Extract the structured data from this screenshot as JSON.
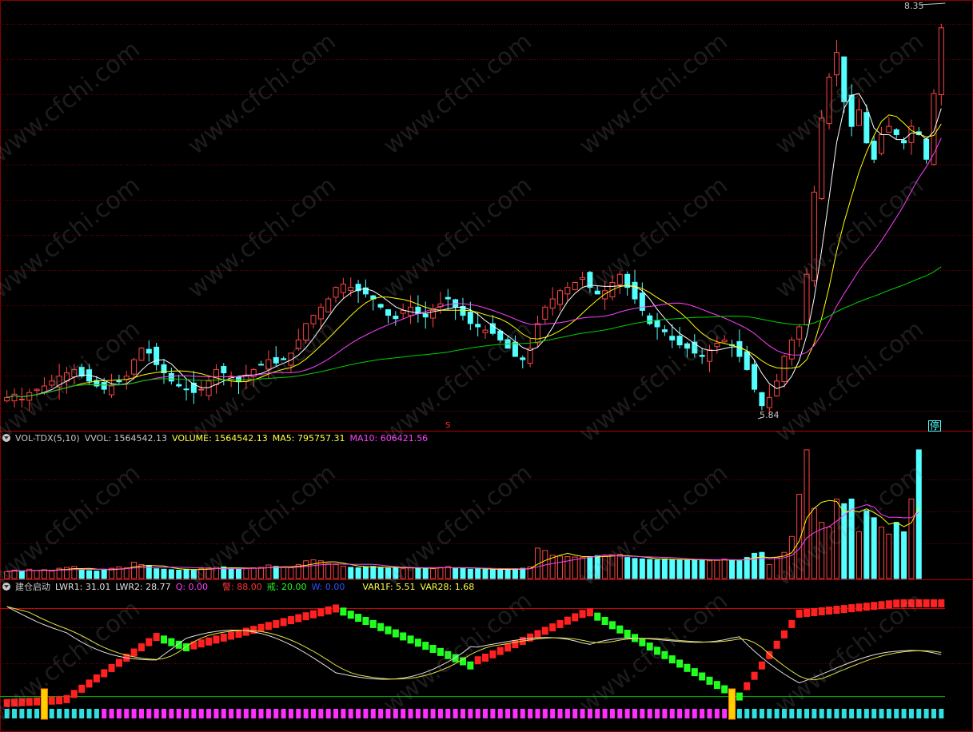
{
  "colors": {
    "up": "#ff4444",
    "down": "#54ffff",
    "ma_white": "#ffffff",
    "ma_yellow": "#ffff00",
    "ma_magenta": "#ff40ff",
    "ma_green": "#00d000",
    "grid": "#7a0000",
    "bg": "#000000"
  },
  "watermark": "www.cfchi.com",
  "main_panel": {
    "high_label": "8.35",
    "low_label": "5.84",
    "marker_s": "S",
    "marker_stop": "停"
  },
  "vol_panel": {
    "header": {
      "name": "VOL-TDX(5,10)",
      "vvol": "VVOL: 1564542.13",
      "volume": "VOLUME: 1564542.13",
      "ma5": "MA5: 795757.31",
      "ma10": "MA10: 606421.56"
    }
  },
  "ind_panel": {
    "header": {
      "name": "建仓启动",
      "lwr1": "LWR1: 31.01",
      "lwr2": "LWR2: 28.77",
      "q": "Q: 0.00",
      "jing": "警: 88.00",
      "jie": "戒: 20.00",
      "w": "W: 0.00",
      "var1f": "VAR1F: 5.51",
      "var28": "VAR28: 1.68"
    }
  },
  "chart_data": [
    {
      "type": "candlestick",
      "panel": "price",
      "price_high": 8.35,
      "price_low": 5.84,
      "closes": [
        5.95,
        5.97,
        5.94,
        5.98,
        6.0,
        6.02,
        6.05,
        6.08,
        6.1,
        6.12,
        6.08,
        6.05,
        6.02,
        6.0,
        6.02,
        6.05,
        6.08,
        6.18,
        6.25,
        6.22,
        6.15,
        6.1,
        6.05,
        6.02,
        6.0,
        5.98,
        6.0,
        6.05,
        6.12,
        6.1,
        6.08,
        6.05,
        6.08,
        6.12,
        6.15,
        6.18,
        6.16,
        6.18,
        6.22,
        6.3,
        6.4,
        6.45,
        6.5,
        6.55,
        6.62,
        6.64,
        6.62,
        6.6,
        6.58,
        6.55,
        6.5,
        6.45,
        6.43,
        6.48,
        6.5,
        6.46,
        6.44,
        6.48,
        6.52,
        6.55,
        6.5,
        6.45,
        6.4,
        6.38,
        6.36,
        6.34,
        6.3,
        6.25,
        6.2,
        6.18,
        6.25,
        6.4,
        6.5,
        6.55,
        6.6,
        6.62,
        6.65,
        6.68,
        6.62,
        6.58,
        6.6,
        6.65,
        6.7,
        6.62,
        6.55,
        6.48,
        6.4,
        6.38,
        6.35,
        6.3,
        6.27,
        6.25,
        6.22,
        6.2,
        6.24,
        6.28,
        6.3,
        6.27,
        6.2,
        6.12,
        6.0,
        5.9,
        5.95,
        6.05,
        6.2,
        6.3,
        6.38,
        6.7,
        7.2,
        7.65,
        7.9,
        8.05,
        7.75,
        7.6,
        7.7,
        7.5,
        7.4,
        7.55,
        7.6,
        7.55,
        7.5,
        7.6,
        7.55,
        7.4,
        7.8,
        8.2
      ]
    },
    {
      "type": "bar",
      "panel": "volume",
      "series": [
        {
          "name": "VOLUME",
          "values": [
            150,
            180,
            160,
            200,
            170,
            190,
            160,
            220,
            240,
            260,
            190,
            170,
            160,
            200,
            220,
            250,
            230,
            350,
            300,
            280,
            210,
            200,
            190,
            180,
            200,
            190,
            210,
            230,
            240,
            250,
            220,
            200,
            210,
            230,
            240,
            290,
            260,
            240,
            230,
            300,
            380,
            400,
            380,
            320,
            300,
            260,
            240,
            230,
            250,
            260,
            240,
            220,
            230,
            210,
            240,
            230,
            220,
            210,
            240,
            260,
            230,
            220,
            200,
            210,
            200,
            190,
            180,
            200,
            210,
            220,
            250,
            650,
            600,
            500,
            480,
            470,
            460,
            450,
            470,
            490,
            480,
            510,
            520,
            450,
            430,
            420,
            410,
            400,
            420,
            410,
            400,
            390,
            410,
            400,
            380,
            390,
            420,
            400,
            380,
            450,
            540,
            560,
            300,
            450,
            560,
            900,
            1800,
            2750,
            1500,
            1200,
            1100,
            1700,
            1600,
            1700,
            1000,
            1450,
            1300,
            1100,
            950,
            1200,
            1000,
            1700,
            2750
          ]
        }
      ]
    },
    {
      "type": "line",
      "panel": "indicator",
      "lines": [
        {
          "name": "警",
          "value": 88
        },
        {
          "name": "戒",
          "value": 20
        }
      ]
    }
  ]
}
